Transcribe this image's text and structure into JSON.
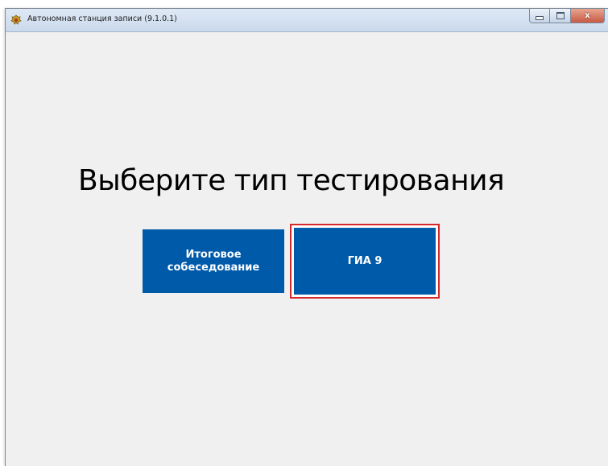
{
  "window": {
    "title": "Автономная станция записи (9.1.0.1)",
    "icon": "app-emblem-icon"
  },
  "title_controls": {
    "minimize_icon": "minimize-icon",
    "maximize_icon": "maximize-icon",
    "close_label": "x"
  },
  "main": {
    "heading": "Выберите тип тестирования",
    "buttons": {
      "final_interview": "Итоговое собеседование",
      "gia9": "ГИА 9"
    }
  },
  "colors": {
    "button_bg": "#005aaa",
    "button_text": "#ffffff",
    "highlight": "#d62828",
    "client_bg": "#f0f0f0"
  }
}
